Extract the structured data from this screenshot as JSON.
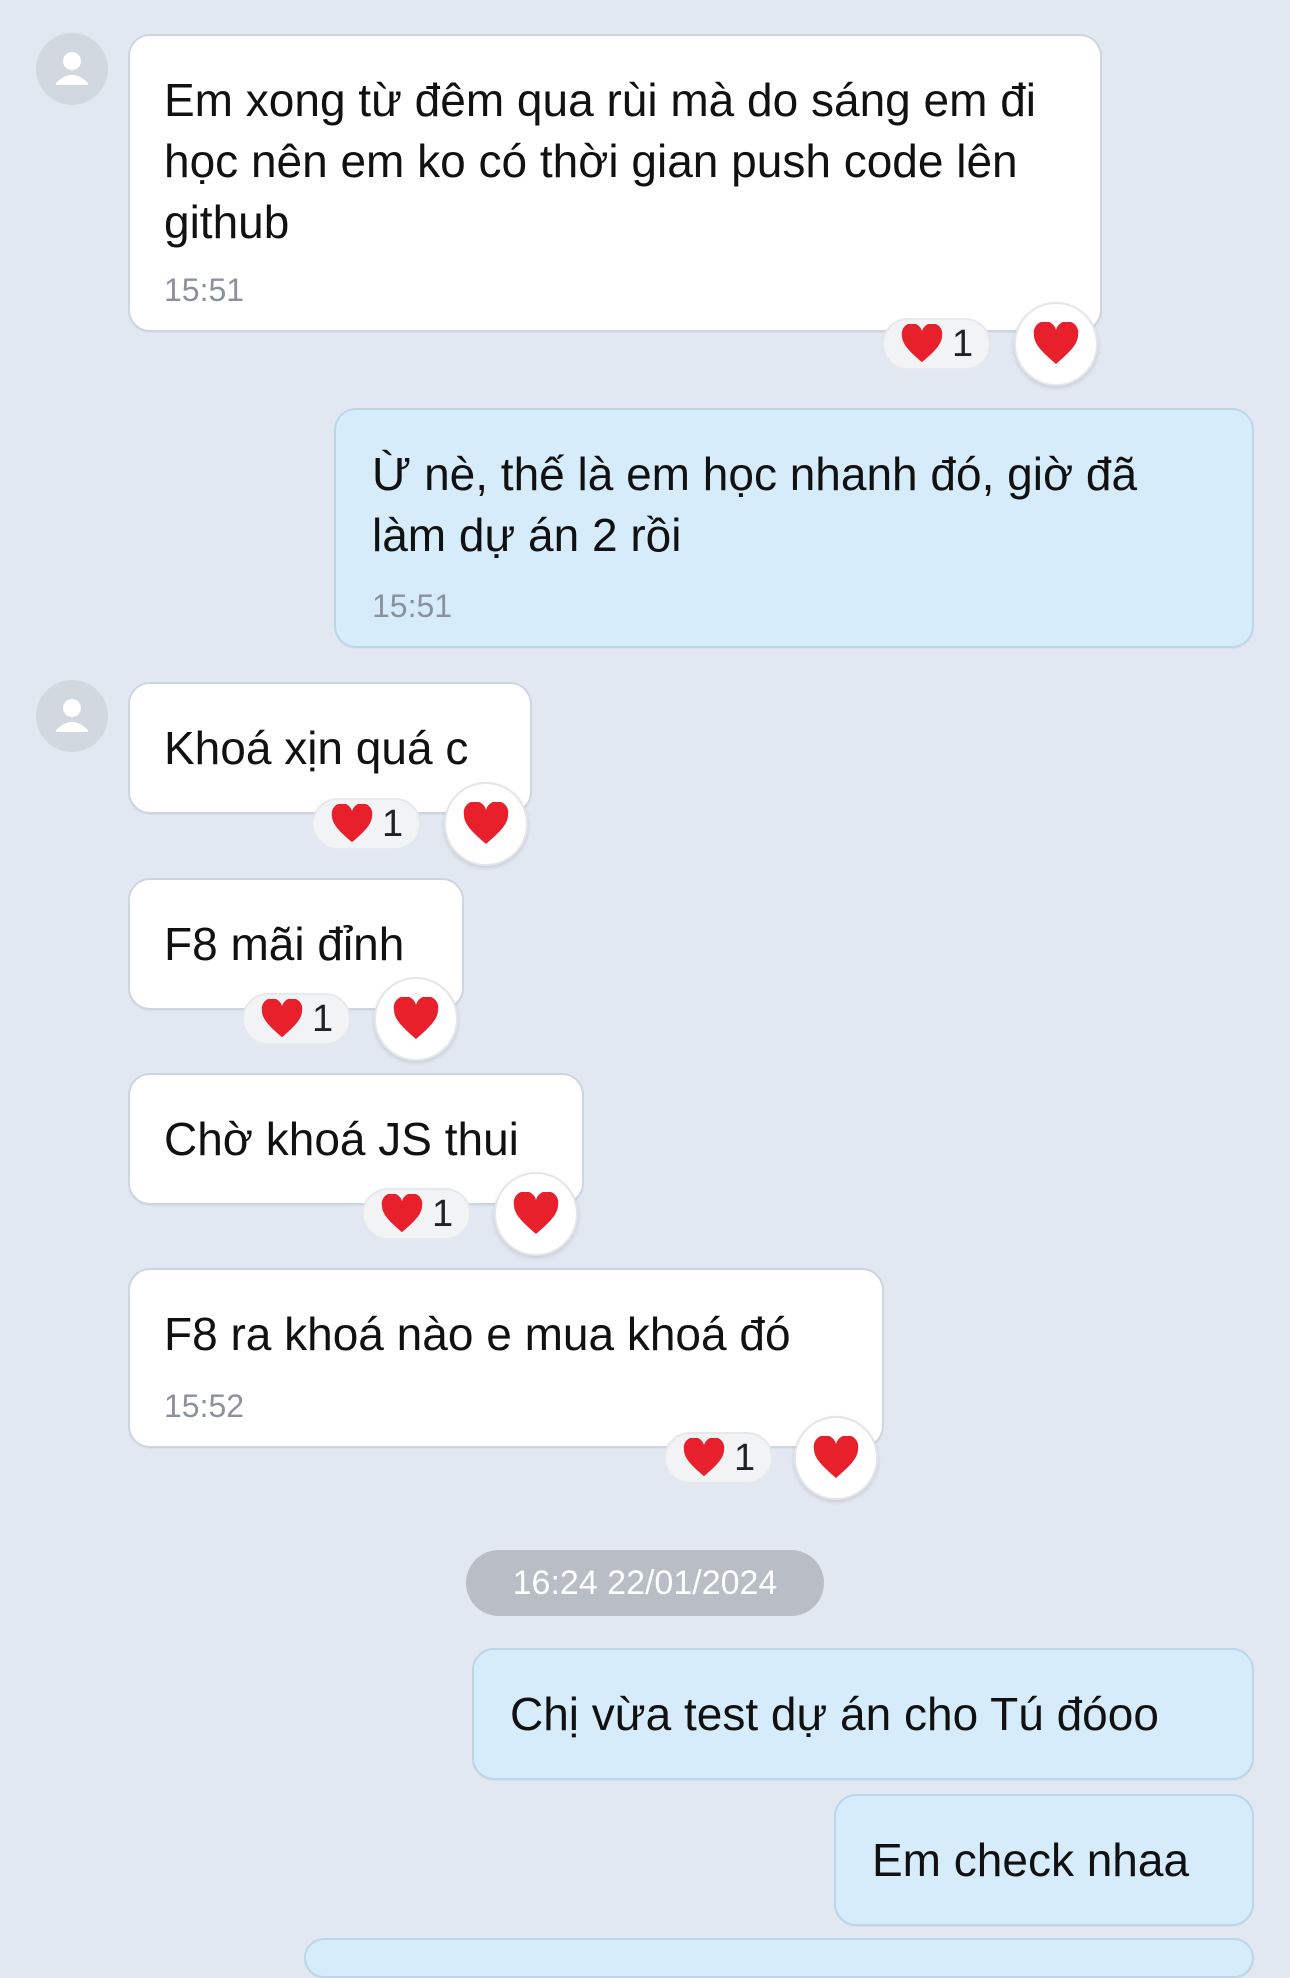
{
  "messages": [
    {
      "text": "Em xong từ đêm qua rùi mà do sáng em đi học nên em ko có thời gian push code lên github",
      "time": "15:51",
      "reaction_count": "1"
    },
    {
      "text": "Ừ nè, thế là em học nhanh đó, giờ đã làm dự án 2 rồi",
      "time": "15:51"
    },
    {
      "text": "Khoá xịn quá c",
      "reaction_count": "1"
    },
    {
      "text": "F8 mãi đỉnh",
      "reaction_count": "1"
    },
    {
      "text": "Chờ khoá JS thui",
      "reaction_count": "1"
    },
    {
      "text": "F8 ra khoá nào e mua khoá đó",
      "time": "15:52",
      "reaction_count": "1"
    },
    {
      "text": "Chị vừa test dự án cho Tú đóoo"
    },
    {
      "text": "Em check nhaa"
    }
  ],
  "date_separator": "16:24 22/01/2024",
  "icons": {
    "avatar": "person-icon",
    "reaction": "heart-icon"
  },
  "colors": {
    "background": "#e2e8f1",
    "incoming": "#ffffff",
    "outgoing": "#d6ecfb",
    "heart": "#e8202b"
  }
}
